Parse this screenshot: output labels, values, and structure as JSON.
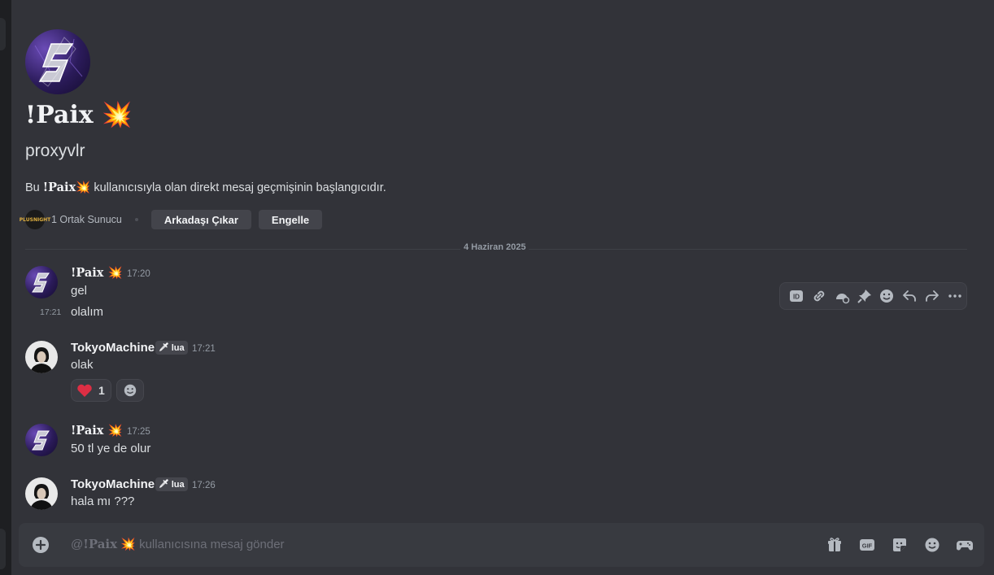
{
  "intro": {
    "display_name": "!Paix",
    "name_emoji": "💥",
    "username": "proxyvlr",
    "description_prefix": "Bu",
    "description_suffix": "kullanıcısıyla olan direkt mesaj geçmişinin başlangıcıdır.",
    "mutual_servers": "1 Ortak Sunucu",
    "server_icon_text": "PLUSNIGHT",
    "remove_friend_label": "Arkadaşı Çıkar",
    "block_label": "Engelle"
  },
  "date_divider": "4 Haziran 2025",
  "messages": [
    {
      "author": "!Paix",
      "emoji": "💥",
      "time": "17:20",
      "text": "gel"
    },
    {
      "time": "17:21",
      "text": "olalım"
    },
    {
      "author": "TokyoMachine",
      "tag": "lua",
      "time": "17:21",
      "text": "olak"
    },
    {
      "author": "!Paix",
      "emoji": "💥",
      "time": "17:25",
      "text": "50 tl ye de olur"
    },
    {
      "author": "TokyoMachine",
      "tag": "lua",
      "time": "17:26",
      "text": "hala mı ???"
    }
  ],
  "reaction": {
    "emoji": "❤",
    "count": "1"
  },
  "toolbar_icons": [
    "id-icon",
    "link-icon",
    "thread-icon",
    "pin-icon",
    "emoji-icon",
    "reply-icon",
    "forward-icon",
    "more-icon"
  ],
  "composer": {
    "prefix": "@",
    "name": "!Paix",
    "emoji": "💥",
    "placeholder_suffix": "kullanıcısına mesaj gönder",
    "icons": [
      "gift-icon",
      "gif-icon",
      "sticker-icon",
      "emoji-icon",
      "apps-icon"
    ],
    "gif_label": "GIF"
  },
  "colors": {
    "background": "#323339",
    "composer": "#383a40",
    "reaction_heart": "#dd2e44"
  }
}
